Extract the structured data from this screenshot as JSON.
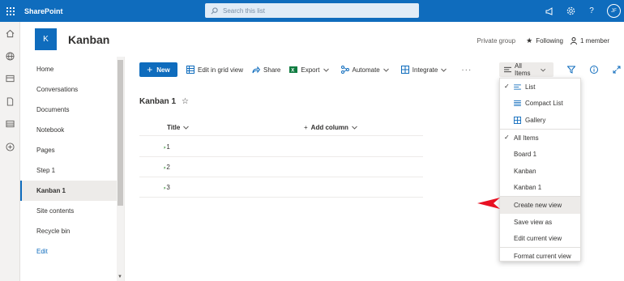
{
  "suite": {
    "title": "SharePoint",
    "search_placeholder": "Search this list",
    "avatar_initials": "JF"
  },
  "site": {
    "logo_letter": "K",
    "title": "Kanban",
    "privacy": "Private group",
    "following": "Following",
    "members": "1 member"
  },
  "leftnav": {
    "items": [
      {
        "label": "Home"
      },
      {
        "label": "Conversations"
      },
      {
        "label": "Documents"
      },
      {
        "label": "Notebook"
      },
      {
        "label": "Pages"
      },
      {
        "label": "Step 1"
      },
      {
        "label": "Kanban 1"
      },
      {
        "label": "Site contents"
      },
      {
        "label": "Recycle bin"
      },
      {
        "label": "Edit"
      }
    ],
    "selected": "Kanban 1"
  },
  "commandbar": {
    "new_label": "New",
    "grid_label": "Edit in grid view",
    "share_label": "Share",
    "export_label": "Export",
    "automate_label": "Automate",
    "integrate_label": "Integrate",
    "more_label": "···",
    "view_label": "All Items"
  },
  "list": {
    "title": "Kanban 1",
    "columns": {
      "title": "Title",
      "add": "Add column"
    },
    "rows": [
      {
        "title": "1"
      },
      {
        "title": "2"
      },
      {
        "title": "3"
      }
    ]
  },
  "view_menu": {
    "layouts": [
      {
        "label": "List",
        "checked": true
      },
      {
        "label": "Compact List",
        "checked": false
      },
      {
        "label": "Gallery",
        "checked": false
      }
    ],
    "views": [
      {
        "label": "All Items",
        "checked": true
      },
      {
        "label": "Board 1"
      },
      {
        "label": "Kanban"
      },
      {
        "label": "Kanban 1"
      }
    ],
    "actions": [
      {
        "label": "Create new view"
      },
      {
        "label": "Save view as"
      },
      {
        "label": "Edit current view"
      }
    ],
    "format": {
      "label": "Format current view"
    },
    "highlighted": "Create new view"
  },
  "colors": {
    "brand": "#0f6cbd",
    "pointer": "#e81123"
  }
}
